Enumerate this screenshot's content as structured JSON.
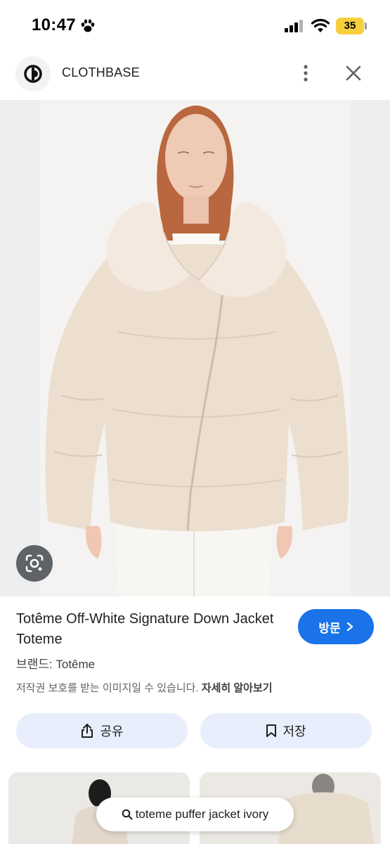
{
  "status_bar": {
    "time": "10:47",
    "battery_level": "35",
    "battery_color": "#f7cf3b",
    "icons": [
      "paw-icon",
      "signal-icon",
      "wifi-icon",
      "battery-icon"
    ]
  },
  "header": {
    "site_name": "CLOTHBASE",
    "logo_icon": "clothbase-logo-icon",
    "more_icon": "more-vert-icon",
    "close_icon": "close-icon"
  },
  "image": {
    "lens_icon": "lens-icon"
  },
  "product": {
    "title": "Totême Off-White Signature Down Jacket Toteme",
    "visit_label": "방문",
    "visit_icon": "chevron-right-icon",
    "brand": "브랜드: Totême",
    "copyright_notice": "저작권 보호를 받는 이미지일 수 있습니다.",
    "learn_more": "자세히 알아보기"
  },
  "actions": {
    "share_label": "공유",
    "share_icon": "share-icon",
    "save_label": "저장",
    "save_icon": "bookmark-icon"
  },
  "search": {
    "query": "toteme puffer jacket ivory",
    "icon": "search-icon"
  },
  "colors": {
    "accent": "#1a73e8",
    "action_button_bg": "#e8eefb",
    "jacket": "#ece0d2"
  }
}
